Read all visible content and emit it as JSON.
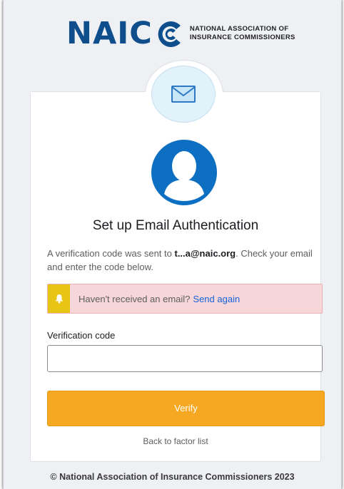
{
  "logo": {
    "wordmark": "NAIC",
    "line1": "NATIONAL ASSOCIATION OF",
    "line2": "INSURANCE COMMISSIONERS",
    "brand_color": "#0e4e8c"
  },
  "icons": {
    "badge": "envelope-icon",
    "avatar": "user-avatar-icon",
    "alert": "bell-icon"
  },
  "card": {
    "title": "Set up Email Authentication",
    "desc_prefix": "A verification code was sent to ",
    "desc_email": "t...a@naic.org",
    "desc_suffix": ". Check your email and enter the code below.",
    "alert_text": "Haven't received an email?",
    "alert_link": "Send again",
    "field_label": "Verification code",
    "field_value": "",
    "field_placeholder": "",
    "verify_label": "Verify",
    "back_label": "Back to factor list"
  },
  "colors": {
    "accent_button": "#f7a823",
    "alert_bg": "#f6d6d8",
    "alert_icon_bg": "#e8c515",
    "link": "#1662dd"
  },
  "footer": {
    "text": "© National Association of Insurance Commissioners 2023"
  }
}
